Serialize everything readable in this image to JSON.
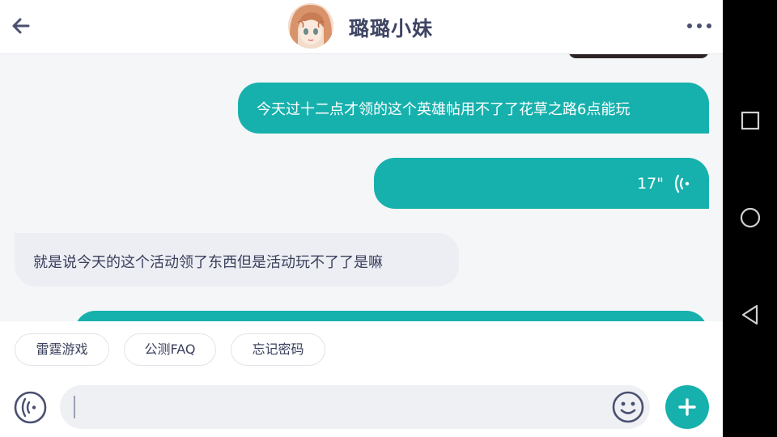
{
  "header": {
    "title": "璐璐小妹"
  },
  "messages": {
    "outgoing_text": "今天过十二点才领的这个英雄帖用不了了花草之路6点能玩",
    "outgoing_voice_duration": "17\"",
    "incoming_text": "就是说今天的这个活动领了东西但是活动玩不了了是嘛"
  },
  "quick_replies": [
    "雷霆游戏",
    "公测FAQ",
    "忘记密码"
  ],
  "input": {
    "value": "",
    "placeholder": ""
  },
  "colors": {
    "accent": "#17b1ad",
    "incoming_bubble": "#eceef3",
    "text": "#3a3f5c",
    "title": "#3f4563",
    "nav_bar": "#000000"
  },
  "icons": {
    "back": "arrow-left-icon",
    "more": "more-dots-icon",
    "voice_playback": "voice-wave-icon",
    "voice_input": "voice-input-icon",
    "emoji": "smiley-icon",
    "add": "plus-icon",
    "nav_recents": "square-icon",
    "nav_home": "circle-icon",
    "nav_back": "triangle-back-icon"
  }
}
